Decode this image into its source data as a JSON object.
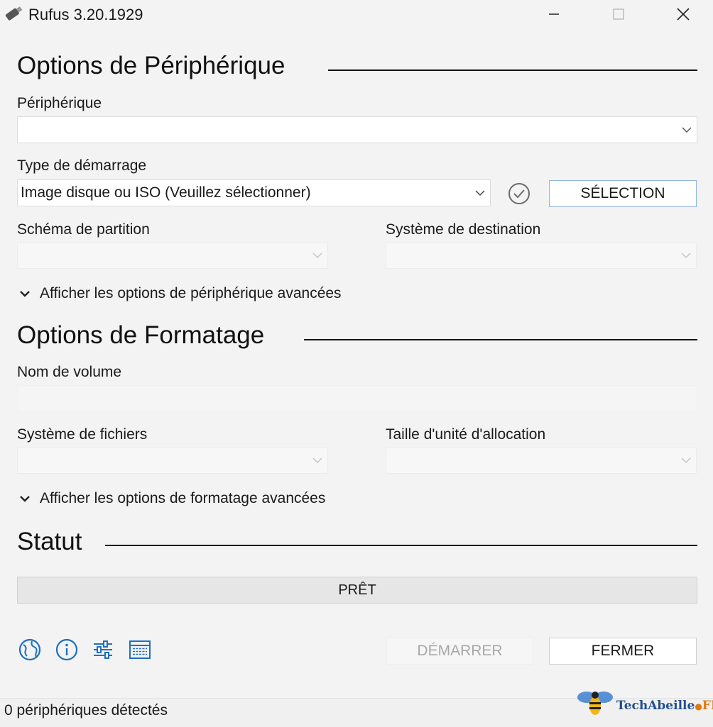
{
  "window": {
    "title": "Rufus 3.20.1929",
    "minimize": "minimize",
    "maximize": "maximize",
    "close": "close"
  },
  "device_options": {
    "title": "Options de Périphérique",
    "device_label": "Périphérique",
    "device_value": "",
    "boot_label": "Type de démarrage",
    "boot_value": "Image disque ou ISO (Veuillez sélectionner)",
    "select_button": "SÉLECTION",
    "partition_label": "Schéma de partition",
    "partition_value": "",
    "target_label": "Système de destination",
    "target_value": "",
    "advanced_toggle": "Afficher les options de périphérique avancées"
  },
  "format_options": {
    "title": "Options de Formatage",
    "volume_label": "Nom de volume",
    "volume_value": "",
    "filesystem_label": "Système de fichiers",
    "filesystem_value": "",
    "cluster_label": "Taille d'unité d'allocation",
    "cluster_value": "",
    "advanced_toggle": "Afficher les options de formatage avancées"
  },
  "status": {
    "title": "Statut",
    "progress_text": "PRÊT"
  },
  "toolbar": {
    "icons": [
      "globe-icon",
      "info-icon",
      "settings-sliders-icon",
      "log-table-icon"
    ],
    "start_button": "DÉMARRER",
    "close_button": "FERMER"
  },
  "statusbar": {
    "text": "0 périphériques détectés"
  },
  "watermark": {
    "text": "TechAbeille",
    "suffix": "FR"
  },
  "colors": {
    "accent_blue": "#1e6fbf",
    "background": "#f3f3f3",
    "button_border_primary": "#8fb4e0"
  }
}
